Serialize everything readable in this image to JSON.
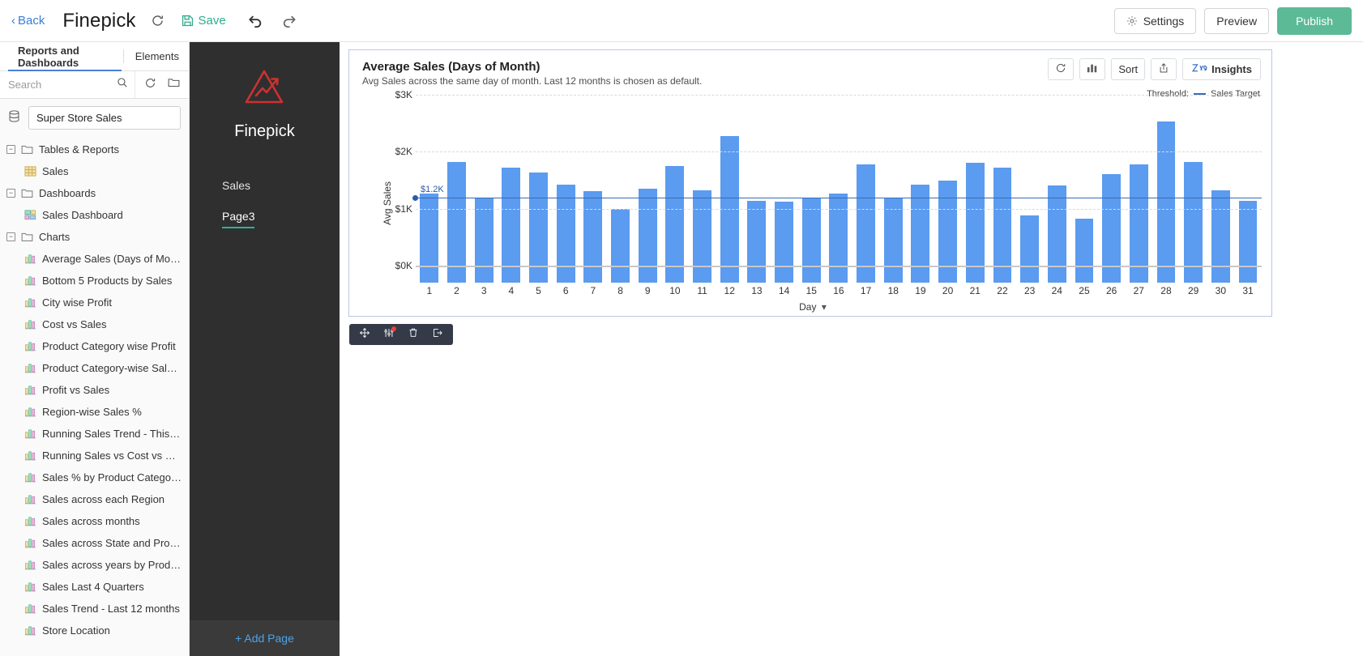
{
  "topbar": {
    "back_label": "Back",
    "app_title": "Finepick",
    "refresh_icon": "refresh-icon",
    "save_label": "Save",
    "undo_icon": "undo-icon",
    "redo_icon": "redo-icon",
    "settings_label": "Settings",
    "preview_label": "Preview",
    "publish_label": "Publish",
    "publish_color": "#5cba96",
    "save_color": "#2fab8e"
  },
  "sidebar": {
    "tabs": [
      {
        "label": "Reports and Dashboards",
        "active": true
      },
      {
        "label": "Elements",
        "active": false
      }
    ],
    "search": {
      "placeholder": "Search",
      "value": ""
    },
    "workspace": "Super Store Sales",
    "tree": [
      {
        "label": "Tables & Reports",
        "type": "group",
        "icon": "folder-icon",
        "expander": "−"
      },
      {
        "label": "Sales",
        "type": "table",
        "icon": "table-icon"
      },
      {
        "label": "Dashboards",
        "type": "group",
        "icon": "folder-icon",
        "expander": "−"
      },
      {
        "label": "Sales Dashboard",
        "type": "dashboard",
        "icon": "dashboard-icon"
      },
      {
        "label": "Charts",
        "type": "group",
        "icon": "folder-icon",
        "expander": "−"
      },
      {
        "label": "Average Sales (Days of Mon…",
        "type": "chart",
        "icon": "bar-chart-icon"
      },
      {
        "label": "Bottom 5 Products by Sales",
        "type": "chart",
        "icon": "bar-chart-icon"
      },
      {
        "label": "City wise Profit",
        "type": "chart",
        "icon": "bar-chart-icon"
      },
      {
        "label": "Cost vs Sales",
        "type": "chart",
        "icon": "bar-chart-icon"
      },
      {
        "label": "Product Category wise Profit",
        "type": "chart",
        "icon": "bar-chart-icon"
      },
      {
        "label": "Product Category-wise Sal…",
        "type": "chart",
        "icon": "bar-chart-icon"
      },
      {
        "label": "Profit vs Sales",
        "type": "chart",
        "icon": "bar-chart-icon"
      },
      {
        "label": "Region-wise Sales %",
        "type": "chart",
        "icon": "bar-chart-icon"
      },
      {
        "label": "Running Sales Trend - This …",
        "type": "chart",
        "icon": "bar-chart-icon"
      },
      {
        "label": "Running Sales vs Cost vs Pr…",
        "type": "chart",
        "icon": "bar-chart-icon"
      },
      {
        "label": "Sales % by Product Categor…",
        "type": "chart",
        "icon": "bar-chart-icon"
      },
      {
        "label": "Sales across each Region",
        "type": "chart",
        "icon": "bar-chart-icon"
      },
      {
        "label": "Sales across months",
        "type": "chart",
        "icon": "bar-chart-icon"
      },
      {
        "label": "Sales across State and Prod…",
        "type": "chart",
        "icon": "bar-chart-icon"
      },
      {
        "label": "Sales across years by Produ…",
        "type": "chart",
        "icon": "bar-chart-icon"
      },
      {
        "label": "Sales Last 4 Quarters",
        "type": "chart",
        "icon": "bar-chart-icon"
      },
      {
        "label": "Sales Trend - Last 12 months",
        "type": "chart",
        "icon": "bar-chart-icon"
      },
      {
        "label": "Store Location",
        "type": "chart",
        "icon": "bar-chart-icon"
      }
    ]
  },
  "pagepanel": {
    "brand": "Finepick",
    "logo_icon": "finepick-logo-icon",
    "logo_color": "#cf3030",
    "pages": [
      {
        "label": "Sales",
        "active": false
      },
      {
        "label": "Page3",
        "active": true
      }
    ],
    "add_page_label": "+ Add Page",
    "accent_color": "#2eb398"
  },
  "chart_panel": {
    "tools": [
      {
        "label": "",
        "icon": "refresh-icon",
        "name": "refresh-chart-button"
      },
      {
        "label": "",
        "icon": "bar-chart-icon",
        "name": "chart-type-button"
      },
      {
        "label": "Sort",
        "icon": "",
        "name": "sort-button"
      },
      {
        "label": "",
        "icon": "export-icon",
        "name": "export-button"
      },
      {
        "label": "Insights",
        "icon": "zia-icon",
        "name": "zia-insights-button"
      }
    ],
    "threshold_legend_label": "Threshold:",
    "threshold_series_name": "Sales Target",
    "threshold_color": "#3a6bb5",
    "element_toolbar": [
      {
        "icon": "move-icon",
        "name": "move-element-button",
        "badge": false
      },
      {
        "icon": "filter-settings-icon",
        "name": "chart-settings-button",
        "badge": true
      },
      {
        "icon": "trash-icon",
        "name": "delete-element-button",
        "badge": false
      },
      {
        "icon": "export-element-icon",
        "name": "export-element-button",
        "badge": false
      }
    ]
  },
  "chart_data": {
    "type": "bar",
    "title": "Average Sales (Days of Month)",
    "subtitle": "Avg Sales across the same day of month. Last 12 months is chosen as default.",
    "xlabel": "Day",
    "ylabel": "Avg Sales",
    "ylim": [
      0,
      3000
    ],
    "ytick_labels": [
      "$0K",
      "$1K",
      "$2K",
      "$3K"
    ],
    "ytick_values": [
      0,
      1000,
      2000,
      3000
    ],
    "grid": true,
    "legend_position": "top-right",
    "bar_color": "#5b9bf0",
    "categories": [
      "1",
      "2",
      "3",
      "4",
      "5",
      "6",
      "7",
      "8",
      "9",
      "10",
      "11",
      "12",
      "13",
      "14",
      "15",
      "16",
      "17",
      "18",
      "19",
      "20",
      "21",
      "22",
      "23",
      "24",
      "25",
      "26",
      "27",
      "28",
      "29",
      "30",
      "31"
    ],
    "values": [
      1560,
      2120,
      1500,
      2020,
      1940,
      1720,
      1610,
      1290,
      1650,
      2050,
      1620,
      2570,
      1430,
      1420,
      1500,
      1570,
      2080,
      1480,
      1720,
      1790,
      2100,
      2020,
      1180,
      1700,
      1120,
      1910,
      2080,
      2830,
      2120,
      1620,
      1440
    ],
    "threshold": {
      "value": 1200,
      "label": "$1.2K",
      "name": "Sales Target",
      "color": "#3a6bb5"
    }
  }
}
